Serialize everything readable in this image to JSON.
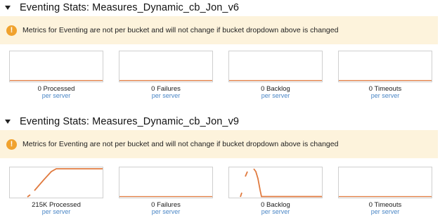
{
  "sections": [
    {
      "title": "Eventing Stats: Measures_Dynamic_cb_Jon_v6",
      "notice": "Metrics for Eventing are not per bucket and will not change if bucket dropdown above is changed",
      "tiles": [
        {
          "label": "0 Processed",
          "sub": "per server"
        },
        {
          "label": "0 Failures",
          "sub": "per server"
        },
        {
          "label": "0 Backlog",
          "sub": "per server"
        },
        {
          "label": "0 Timeouts",
          "sub": "per server"
        }
      ]
    },
    {
      "title": "Eventing Stats: Measures_Dynamic_cb_Jon_v9",
      "notice": "Metrics for Eventing are not per bucket and will not change if bucket dropdown above is changed",
      "tiles": [
        {
          "label": "215K Processed",
          "sub": "per server"
        },
        {
          "label": "0 Failures",
          "sub": "per server"
        },
        {
          "label": "0 Backlog",
          "sub": "per server"
        },
        {
          "label": "0 Timeouts",
          "sub": "per server"
        }
      ]
    }
  ],
  "colors": {
    "line": "#e07a3f",
    "notice_bg": "#fdf3dc",
    "notice_icon": "#f0a22e",
    "sub_text": "#4a86c5"
  },
  "icons": {
    "caret": "caret-down-icon",
    "notice": "warning-icon"
  }
}
